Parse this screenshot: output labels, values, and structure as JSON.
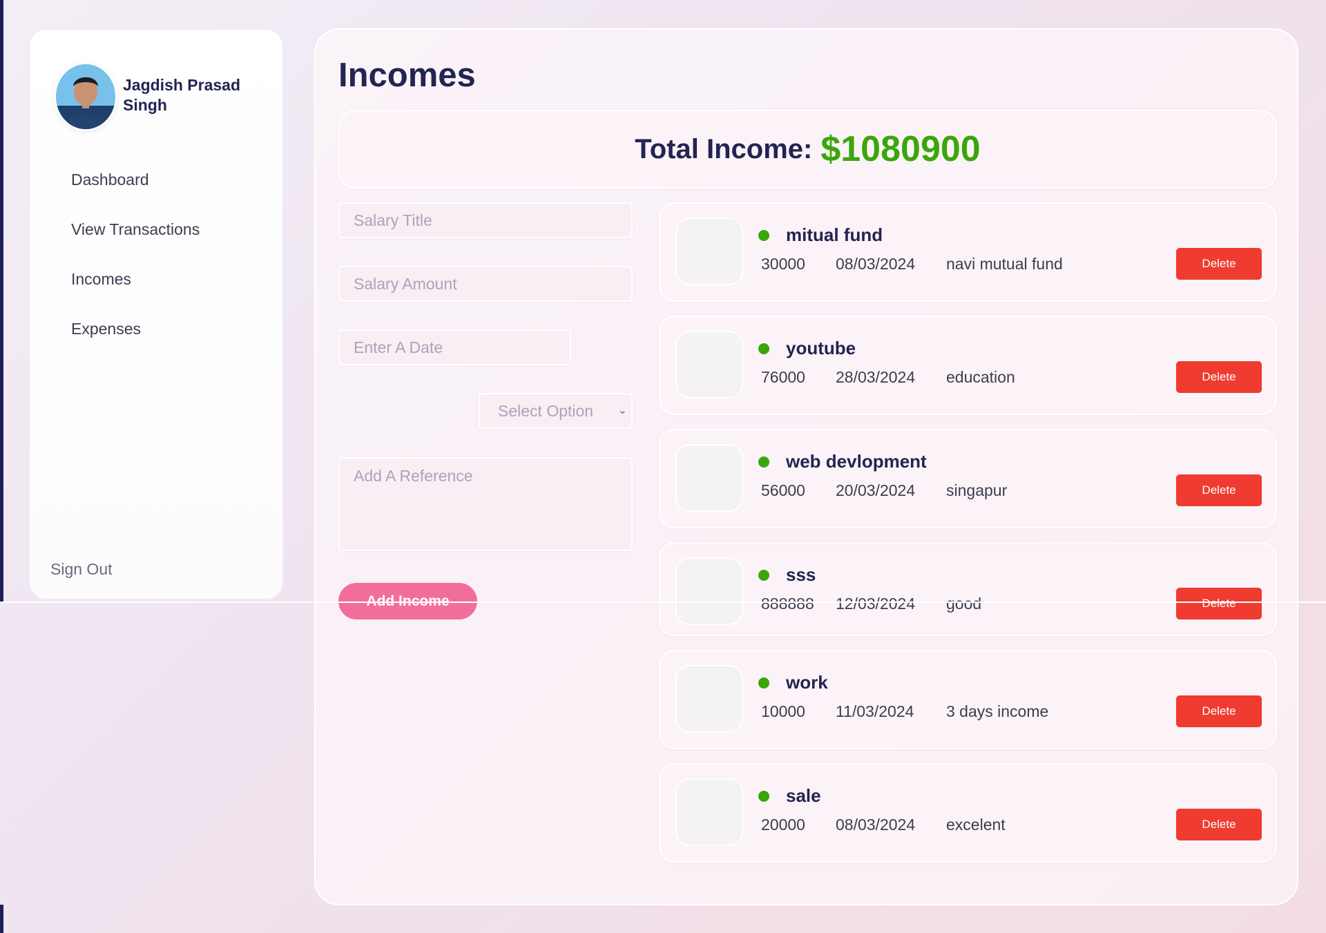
{
  "user": {
    "name": "Jagdish Prasad Singh"
  },
  "sidebar": {
    "items": [
      {
        "label": "Dashboard"
      },
      {
        "label": "View Transactions"
      },
      {
        "label": "Incomes"
      },
      {
        "label": "Expenses"
      }
    ],
    "signout_label": "Sign Out"
  },
  "main": {
    "title": "Incomes",
    "total_label": "Total Income:",
    "total_value": "$1080900"
  },
  "form": {
    "title_placeholder": "Salary Title",
    "amount_placeholder": "Salary Amount",
    "date_placeholder": "Enter A Date",
    "select_label": "Select Option",
    "reference_placeholder": "Add A Reference",
    "submit_label": "Add Income"
  },
  "incomes": [
    {
      "title": "mitual fund",
      "amount": "30000",
      "date": "08/03/2024",
      "reference": "navi mutual fund",
      "delete_label": "Delete"
    },
    {
      "title": "youtube",
      "amount": "76000",
      "date": "28/03/2024",
      "reference": "education",
      "delete_label": "Delete"
    },
    {
      "title": "web devlopment",
      "amount": "56000",
      "date": "20/03/2024",
      "reference": "singapur",
      "delete_label": "Delete"
    },
    {
      "title": "sss",
      "amount": "888888",
      "date": "12/03/2024",
      "reference": "good",
      "delete_label": "Delete"
    },
    {
      "title": "work",
      "amount": "10000",
      "date": "11/03/2024",
      "reference": "3 days income",
      "delete_label": "Delete"
    },
    {
      "title": "sale",
      "amount": "20000",
      "date": "08/03/2024",
      "reference": "excelent",
      "delete_label": "Delete"
    }
  ],
  "colors": {
    "accent_navy": "#232452",
    "income_green": "#3aa60c",
    "delete_red": "#ef3b30",
    "add_pink": "#f26e9a"
  },
  "icons": {
    "status": "status-dot-icon",
    "select_chevron": "chevron-down-icon",
    "avatar": "user-avatar"
  }
}
